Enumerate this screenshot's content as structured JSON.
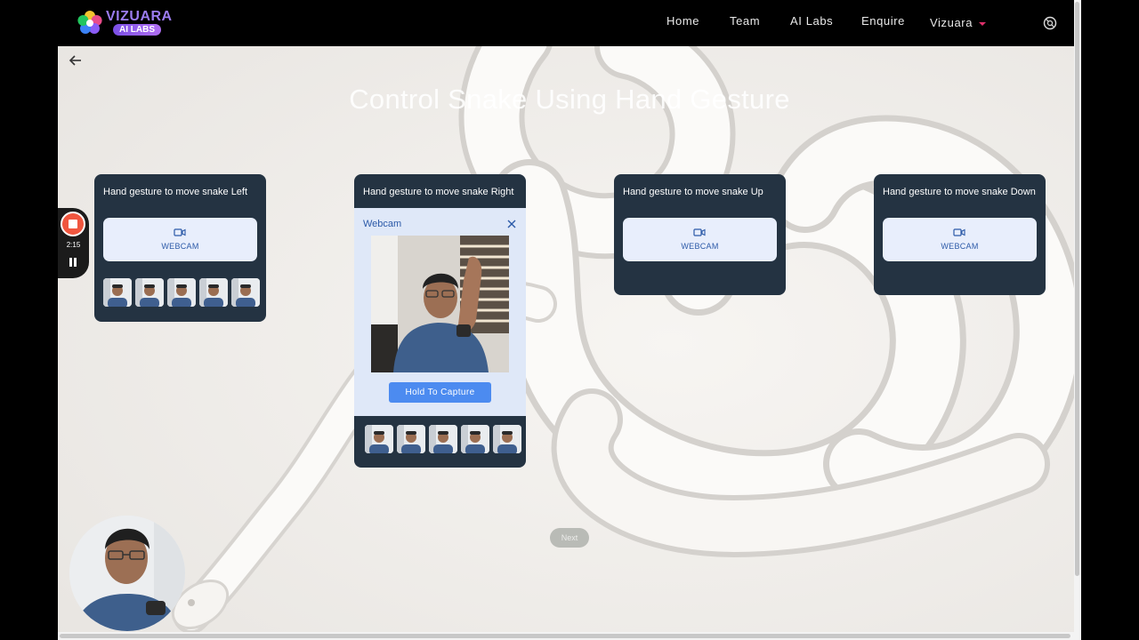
{
  "nav": {
    "brand": "VIZUARA",
    "badge": "AI LABS",
    "links": [
      "Home",
      "Team",
      "AI Labs",
      "Enquire"
    ],
    "account": "Vizuara"
  },
  "page": {
    "title": "Control Snake Using Hand Gesture"
  },
  "cards": [
    {
      "title": "Hand gesture to move snake Left",
      "button": "WEBCAM",
      "samples": 5
    },
    {
      "title": "Hand gesture to move snake Right",
      "samples": 5
    },
    {
      "title": "Hand gesture to move snake Up",
      "button": "WEBCAM",
      "samples": 0
    },
    {
      "title": "Hand gesture to move snake Down",
      "button": "WEBCAM",
      "samples": 0
    }
  ],
  "webcam_panel": {
    "title": "Webcam",
    "capture_label": "Hold To Capture"
  },
  "next_label": "Next",
  "recorder": {
    "time": "2:15"
  },
  "icons": [
    "flower-logo-icon",
    "help-icon",
    "back-arrow-icon",
    "video-camera-icon",
    "close-icon",
    "stop-icon",
    "pause-icon"
  ],
  "colors": {
    "card_bg": "#243342",
    "accent": "#4c8bf0",
    "brand": "#9b7cf0",
    "record": "#f0563f"
  }
}
